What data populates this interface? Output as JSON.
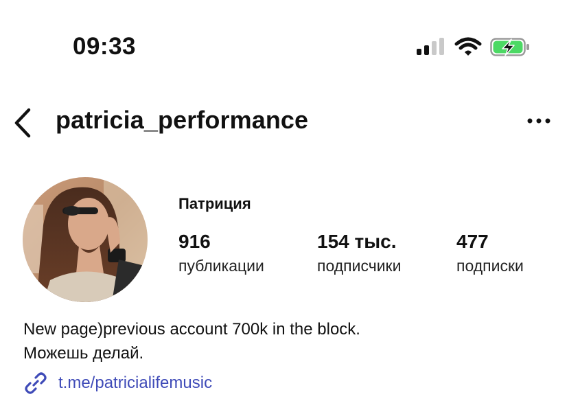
{
  "status_bar": {
    "time": "09:33",
    "icons": [
      "cellular-signal-icon",
      "wifi-icon",
      "battery-charging-icon"
    ],
    "battery_color": "#4cd964"
  },
  "header": {
    "username": "patricia_performance",
    "back_icon": "chevron-left-icon",
    "more_icon": "ellipsis-icon"
  },
  "profile": {
    "display_name": "Патриция",
    "stats": {
      "posts": {
        "value": "916",
        "label": "публикации"
      },
      "followers": {
        "value": "154 тыс.",
        "label": "подписчики"
      },
      "following": {
        "value": "477",
        "label": "подписки"
      }
    },
    "bio_lines": [
      "New page)previous account 700k in the block.",
      "Можешь делай."
    ],
    "link": {
      "text": "t.me/patricialifemusic",
      "icon": "link-icon",
      "color": "#3f4bb8"
    }
  }
}
